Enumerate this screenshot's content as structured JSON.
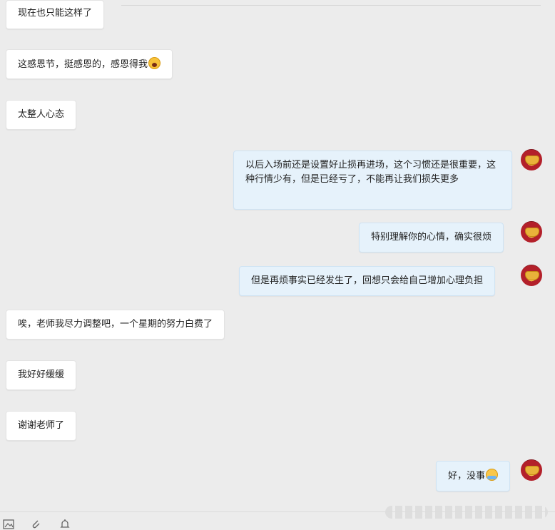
{
  "messages": [
    {
      "side": "in",
      "text": "现在也只能这样了"
    },
    {
      "side": "in",
      "text": "这感恩节，挺感恩的，感恩得我",
      "emoji": "shocked-face-emoji"
    },
    {
      "side": "in",
      "text": "太整人心态"
    },
    {
      "side": "out",
      "text": "以后入场前还是设置好止损再进场，这个习惯还是很重要，这种行情少有，但是已经亏了，不能再让我们损失更多"
    },
    {
      "side": "out",
      "text": "特别理解你的心情，确实很烦"
    },
    {
      "side": "out",
      "text": "但是再烦事实已经发生了，回想只会给自己增加心理负担"
    },
    {
      "side": "in",
      "text": "唉，老师我尽力调整吧，一个星期的努力白费了"
    },
    {
      "side": "in",
      "text": "我好好缓缓"
    },
    {
      "side": "in",
      "text": "谢谢老师了"
    },
    {
      "side": "out",
      "text": "好，没事",
      "emoji": "hug-emoji"
    }
  ],
  "icons": {
    "avatar": "gold-ingot-avatar",
    "toolbar": [
      "image-icon",
      "attachment-icon",
      "notification-icon"
    ]
  },
  "colors": {
    "incoming": "#ffffff",
    "outgoing": "#e6f2fb",
    "background": "#ececec"
  }
}
